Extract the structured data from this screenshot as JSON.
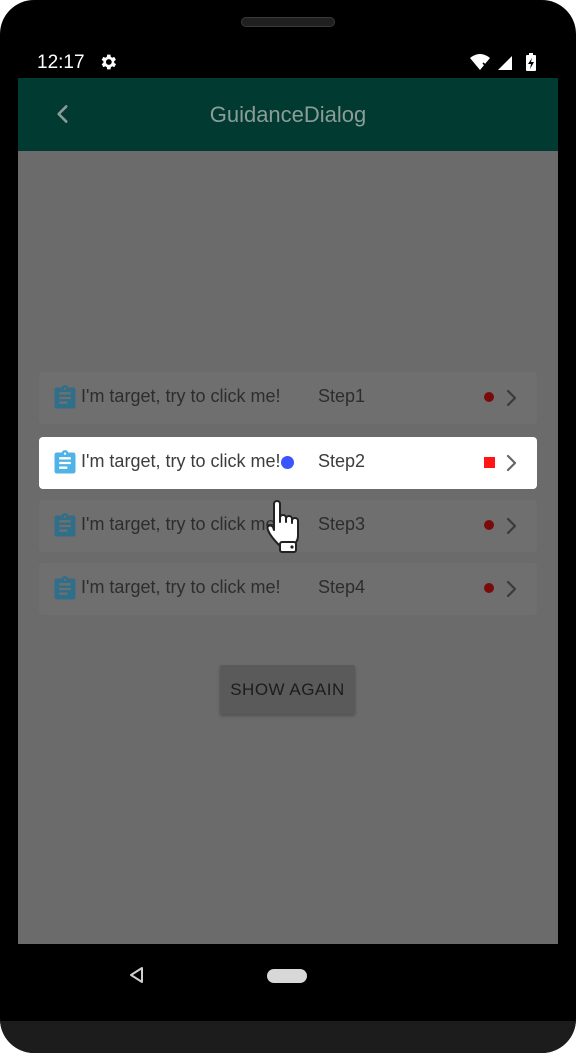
{
  "status_bar": {
    "time": "12:17",
    "icons": [
      "gear-icon",
      "wifi-icon",
      "signal-icon",
      "battery-icon"
    ]
  },
  "app_bar": {
    "title": "GuidanceDialog",
    "back_icon": "chevron-left-icon"
  },
  "list": {
    "items": [
      {
        "label": "I'm target, try to click me!",
        "step": "Step1",
        "highlighted": false
      },
      {
        "label": "I'm target, try to click me!",
        "step": "Step2",
        "highlighted": true
      },
      {
        "label": "I'm target, try to click me!",
        "step": "Step3",
        "highlighted": false
      },
      {
        "label": "I'm target, try to click me!",
        "step": "Step4",
        "highlighted": false
      }
    ]
  },
  "show_again_button": {
    "label": "SHOW AGAIN"
  },
  "colors": {
    "app_bar": "#003a31",
    "overlay": "#6b6b6b",
    "highlight_row": "#ffffff",
    "doc_icon": "#4fb3e8",
    "status_dot": "#7a0b0b",
    "status_square_active": "#ff1515",
    "guide_dot": "#3a55ff"
  }
}
